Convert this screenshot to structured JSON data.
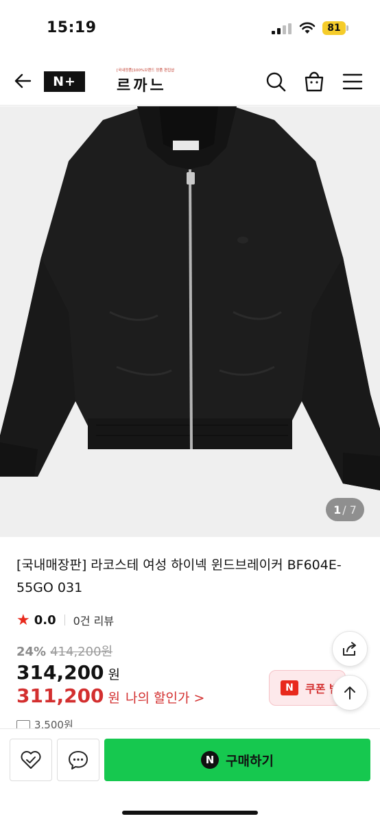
{
  "status_bar": {
    "time": "15:19",
    "battery": "81"
  },
  "header": {
    "logo_text": "N+",
    "brand_tagline": "[국내정품]100%브랜드 정품 편집샵",
    "brand_name": "르까느"
  },
  "gallery": {
    "current": "1",
    "total": "/ 7"
  },
  "product": {
    "title": "[국내매장판] 라코스테 여성 하이넥 윈드브레이커 BF604E-55GO 031",
    "rating": "0.0",
    "review_count": "0건 리뷰",
    "discount_rate": "24%",
    "original_price": "414,200원",
    "price": "314,200",
    "price_unit": "원",
    "coupon_price": "311,200",
    "coupon_unit": "원",
    "coupon_link": "나의 할인가 >",
    "shipping": "3,500원"
  },
  "coupon_button": {
    "badge": "N",
    "label": "쿠폰 받"
  },
  "bottom_bar": {
    "buy_badge": "N",
    "buy_label": "구매하기"
  },
  "colors": {
    "accent_red": "#d32f2f",
    "buy_green": "#16c84f",
    "battery_yellow": "#f5cc2a"
  }
}
